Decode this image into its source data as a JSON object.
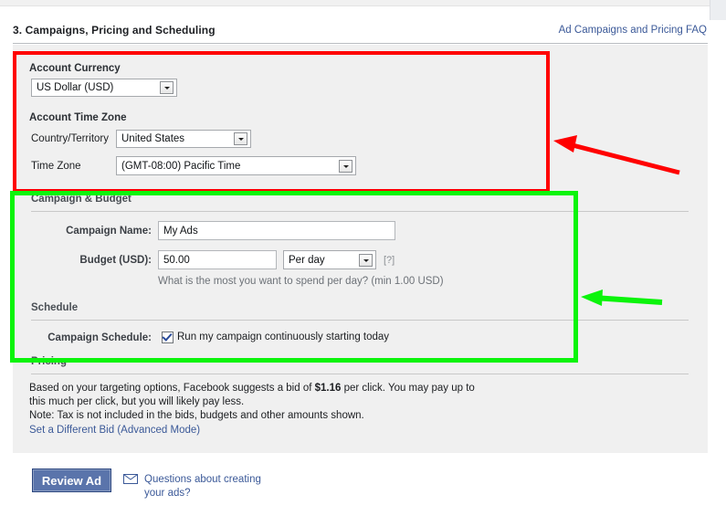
{
  "header": {
    "title": "3. Campaigns, Pricing and Scheduling",
    "faq_link": "Ad Campaigns and Pricing FAQ"
  },
  "account_currency": {
    "heading": "Account Currency",
    "select_value": "US Dollar (USD)"
  },
  "account_time_zone": {
    "heading": "Account Time Zone",
    "country_label": "Country/Territory",
    "country_value": "United States",
    "timezone_label": "Time Zone",
    "timezone_value": "(GMT-08:00) Pacific Time"
  },
  "campaign_budget": {
    "heading": "Campaign & Budget",
    "campaign_name_label": "Campaign Name:",
    "campaign_name_value": "My Ads",
    "budget_label": "Budget (USD):",
    "budget_value": "50.00",
    "budget_period_value": "Per day",
    "help_marker": "[?]",
    "budget_hint": "What is the most you want to spend per day? (min 1.00 USD)"
  },
  "schedule": {
    "heading": "Schedule",
    "schedule_label": "Campaign Schedule:",
    "checkbox_label": "Run my campaign continuously starting today",
    "checkbox_checked": true
  },
  "pricing": {
    "heading": "Pricing",
    "line1_before": "Based on your targeting options, Facebook suggests a bid of ",
    "bid_amount": "$1.16",
    "line1_after": " per click. You may pay up to this much per click, but you will likely pay less.",
    "line2": "Note: Tax is not included in the bids, budgets and other amounts shown.",
    "advanced_link": "Set a Different Bid (Advanced Mode)"
  },
  "footer": {
    "review_button": "Review Ad",
    "questions_link": "Questions about creating your ads?",
    "envelope_icon": "envelope-icon"
  },
  "annotations": {
    "red_box_color": "#ff0000",
    "green_box_color": "#0bf40b",
    "red_arrow": "red-arrow-pointing-left",
    "green_arrow": "green-arrow-pointing-left"
  }
}
